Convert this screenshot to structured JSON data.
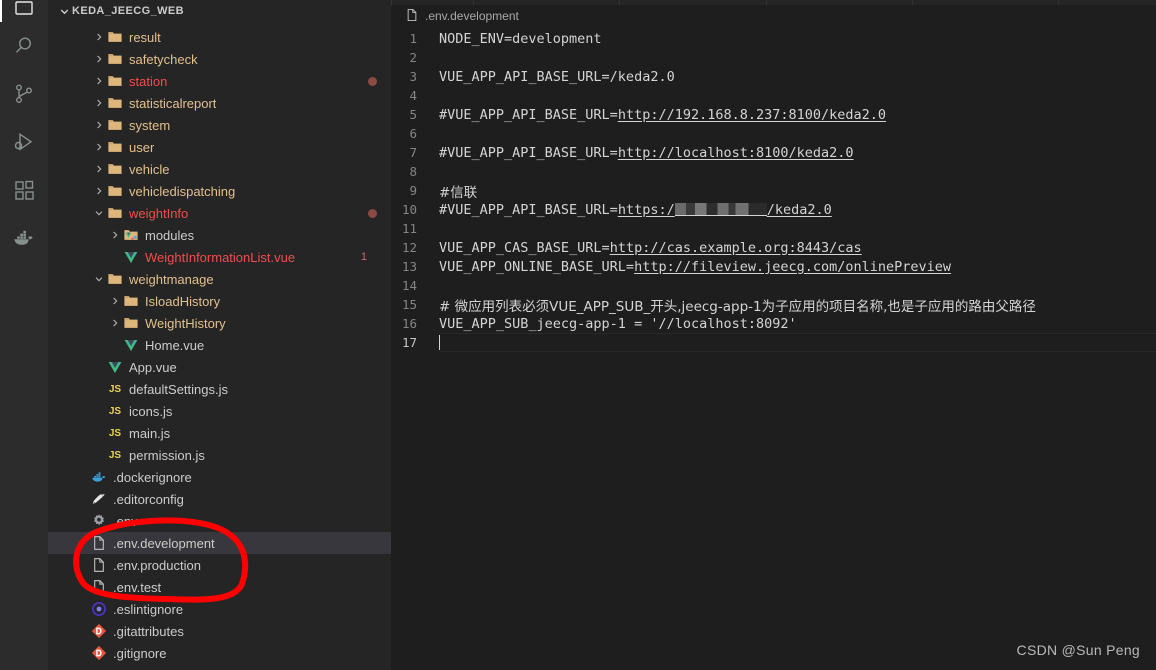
{
  "activitybar": {
    "items": [
      {
        "name": "explorer-icon",
        "label": "Explorer",
        "active": true
      },
      {
        "name": "search-icon",
        "label": "Search",
        "active": false
      },
      {
        "name": "source-control-icon",
        "label": "Source Control",
        "active": false
      },
      {
        "name": "run-and-debug-icon",
        "label": "Run and Debug",
        "active": false
      },
      {
        "name": "extensions-icon",
        "label": "Extensions",
        "active": false
      },
      {
        "name": "docker-icon",
        "label": "Docker",
        "active": false
      }
    ]
  },
  "sidebar": {
    "title": "KEDA_JEECG_WEB",
    "tree": [
      {
        "label": "result",
        "indent": 2,
        "kind": "folder",
        "expandable": true,
        "expanded": false,
        "color": "modified"
      },
      {
        "label": "safetycheck",
        "indent": 2,
        "kind": "folder",
        "expandable": true,
        "expanded": false,
        "color": "modified"
      },
      {
        "label": "station",
        "indent": 2,
        "kind": "folder",
        "expandable": true,
        "expanded": false,
        "color": "error",
        "dot": true
      },
      {
        "label": "statisticalreport",
        "indent": 2,
        "kind": "folder",
        "expandable": true,
        "expanded": false,
        "color": "modified"
      },
      {
        "label": "system",
        "indent": 2,
        "kind": "folder",
        "expandable": true,
        "expanded": false,
        "color": "modified"
      },
      {
        "label": "user",
        "indent": 2,
        "kind": "folder",
        "expandable": true,
        "expanded": false,
        "color": "modified"
      },
      {
        "label": "vehicle",
        "indent": 2,
        "kind": "folder",
        "expandable": true,
        "expanded": false,
        "color": "modified"
      },
      {
        "label": "vehicledispatching",
        "indent": 2,
        "kind": "folder",
        "expandable": true,
        "expanded": false,
        "color": "modified"
      },
      {
        "label": "weightInfo",
        "indent": 2,
        "kind": "folder",
        "expandable": true,
        "expanded": true,
        "color": "error",
        "dot": true
      },
      {
        "label": "modules",
        "indent": 3,
        "kind": "folder-vue",
        "expandable": true,
        "expanded": false,
        "color": "normal"
      },
      {
        "label": "WeightInformationList.vue",
        "indent": 3,
        "kind": "vue",
        "expandable": false,
        "expanded": false,
        "color": "error",
        "badge": "1"
      },
      {
        "label": "weightmanage",
        "indent": 2,
        "kind": "folder",
        "expandable": true,
        "expanded": true,
        "color": "modified"
      },
      {
        "label": "IsloadHistory",
        "indent": 3,
        "kind": "folder",
        "expandable": true,
        "expanded": false,
        "color": "modified"
      },
      {
        "label": "WeightHistory",
        "indent": 3,
        "kind": "folder",
        "expandable": true,
        "expanded": false,
        "color": "modified"
      },
      {
        "label": "Home.vue",
        "indent": 3,
        "kind": "vue",
        "expandable": false,
        "expanded": false,
        "color": "normal"
      },
      {
        "label": "App.vue",
        "indent": 2,
        "kind": "vue",
        "expandable": false,
        "expanded": false,
        "color": "normal"
      },
      {
        "label": "defaultSettings.js",
        "indent": 2,
        "kind": "js",
        "expandable": false,
        "expanded": false,
        "color": "normal"
      },
      {
        "label": "icons.js",
        "indent": 2,
        "kind": "js",
        "expandable": false,
        "expanded": false,
        "color": "normal"
      },
      {
        "label": "main.js",
        "indent": 2,
        "kind": "js",
        "expandable": false,
        "expanded": false,
        "color": "normal"
      },
      {
        "label": "permission.js",
        "indent": 2,
        "kind": "js",
        "expandable": false,
        "expanded": false,
        "color": "normal"
      },
      {
        "label": ".dockerignore",
        "indent": 1,
        "kind": "docker",
        "expandable": false,
        "expanded": false,
        "color": "normal"
      },
      {
        "label": ".editorconfig",
        "indent": 1,
        "kind": "editorconfig",
        "expandable": false,
        "expanded": false,
        "color": "normal"
      },
      {
        "label": ".env",
        "indent": 1,
        "kind": "gear",
        "expandable": false,
        "expanded": false,
        "color": "normal"
      },
      {
        "label": ".env.development",
        "indent": 1,
        "kind": "file",
        "expandable": false,
        "expanded": false,
        "color": "normal",
        "selected": true
      },
      {
        "label": ".env.production",
        "indent": 1,
        "kind": "file",
        "expandable": false,
        "expanded": false,
        "color": "normal"
      },
      {
        "label": ".env.test",
        "indent": 1,
        "kind": "file",
        "expandable": false,
        "expanded": false,
        "color": "normal"
      },
      {
        "label": ".eslintignore",
        "indent": 1,
        "kind": "eslint",
        "expandable": false,
        "expanded": false,
        "color": "normal"
      },
      {
        "label": ".gitattributes",
        "indent": 1,
        "kind": "git",
        "expandable": false,
        "expanded": false,
        "color": "normal"
      },
      {
        "label": ".gitignore",
        "indent": 1,
        "kind": "git",
        "expandable": false,
        "expanded": false,
        "color": "normal"
      }
    ]
  },
  "editor": {
    "breadcrumb_file": ".env.development",
    "lines": [
      {
        "n": "1",
        "segments": [
          {
            "t": "NODE_ENV=development"
          }
        ]
      },
      {
        "n": "2",
        "segments": []
      },
      {
        "n": "3",
        "segments": [
          {
            "t": "VUE_APP_API_BASE_URL=/keda2.0"
          }
        ]
      },
      {
        "n": "4",
        "segments": []
      },
      {
        "n": "5",
        "segments": [
          {
            "t": "#VUE_APP_API_BASE_URL="
          },
          {
            "t": "http://192.168.8.237:8100/keda2.0",
            "link": true
          }
        ]
      },
      {
        "n": "6",
        "segments": []
      },
      {
        "n": "7",
        "segments": [
          {
            "t": "#VUE_APP_API_BASE_URL="
          },
          {
            "t": "http://localhost:8100/keda2.0",
            "link": true
          }
        ]
      },
      {
        "n": "8",
        "segments": []
      },
      {
        "n": "9",
        "segments": [
          {
            "t": "#信联",
            "cjk": true
          }
        ]
      },
      {
        "n": "10",
        "segments": [
          {
            "t": "#VUE_APP_API_BASE_URL="
          },
          {
            "t": "https:/",
            "link": true
          },
          {
            "redacted": true
          },
          {
            "t": "/keda2.0",
            "link": true
          }
        ]
      },
      {
        "n": "11",
        "segments": []
      },
      {
        "n": "12",
        "segments": [
          {
            "t": "VUE_APP_CAS_BASE_URL="
          },
          {
            "t": "http://cas.example.org:8443/cas",
            "link": true
          }
        ]
      },
      {
        "n": "13",
        "segments": [
          {
            "t": "VUE_APP_ONLINE_BASE_URL="
          },
          {
            "t": "http://fileview.jeecg.com/onlinePreview",
            "link": true
          }
        ]
      },
      {
        "n": "14",
        "segments": []
      },
      {
        "n": "15",
        "segments": [
          {
            "t": "# 微应用列表必须VUE_APP_SUB_开头,jeecg-app-1为子应用的项目名称,也是子应用的路由父路径",
            "cjk": true
          }
        ]
      },
      {
        "n": "16",
        "segments": [
          {
            "t": "VUE_APP_SUB_jeecg-app-1 = '//localhost:8092'"
          }
        ]
      },
      {
        "n": "17",
        "segments": [],
        "current": true,
        "caret": true
      }
    ]
  },
  "annotation": {
    "shape": "ellipse",
    "color": "#ff0000",
    "description": "red hand-drawn circle around the .env files"
  },
  "watermark": "CSDN @Sun  Peng",
  "colors": {
    "editor_background": "#1e1e1e",
    "sidebar_background": "#252526",
    "activitybar_background": "#2c2c2c",
    "selection_background": "#37373d",
    "text_default": "#d4d4d4",
    "line_number": "#858585",
    "folder_modified": "#e2c08d",
    "error_text": "#f14c4c",
    "status_dot": "#8c4a43",
    "annotation_red": "#ff0000"
  }
}
